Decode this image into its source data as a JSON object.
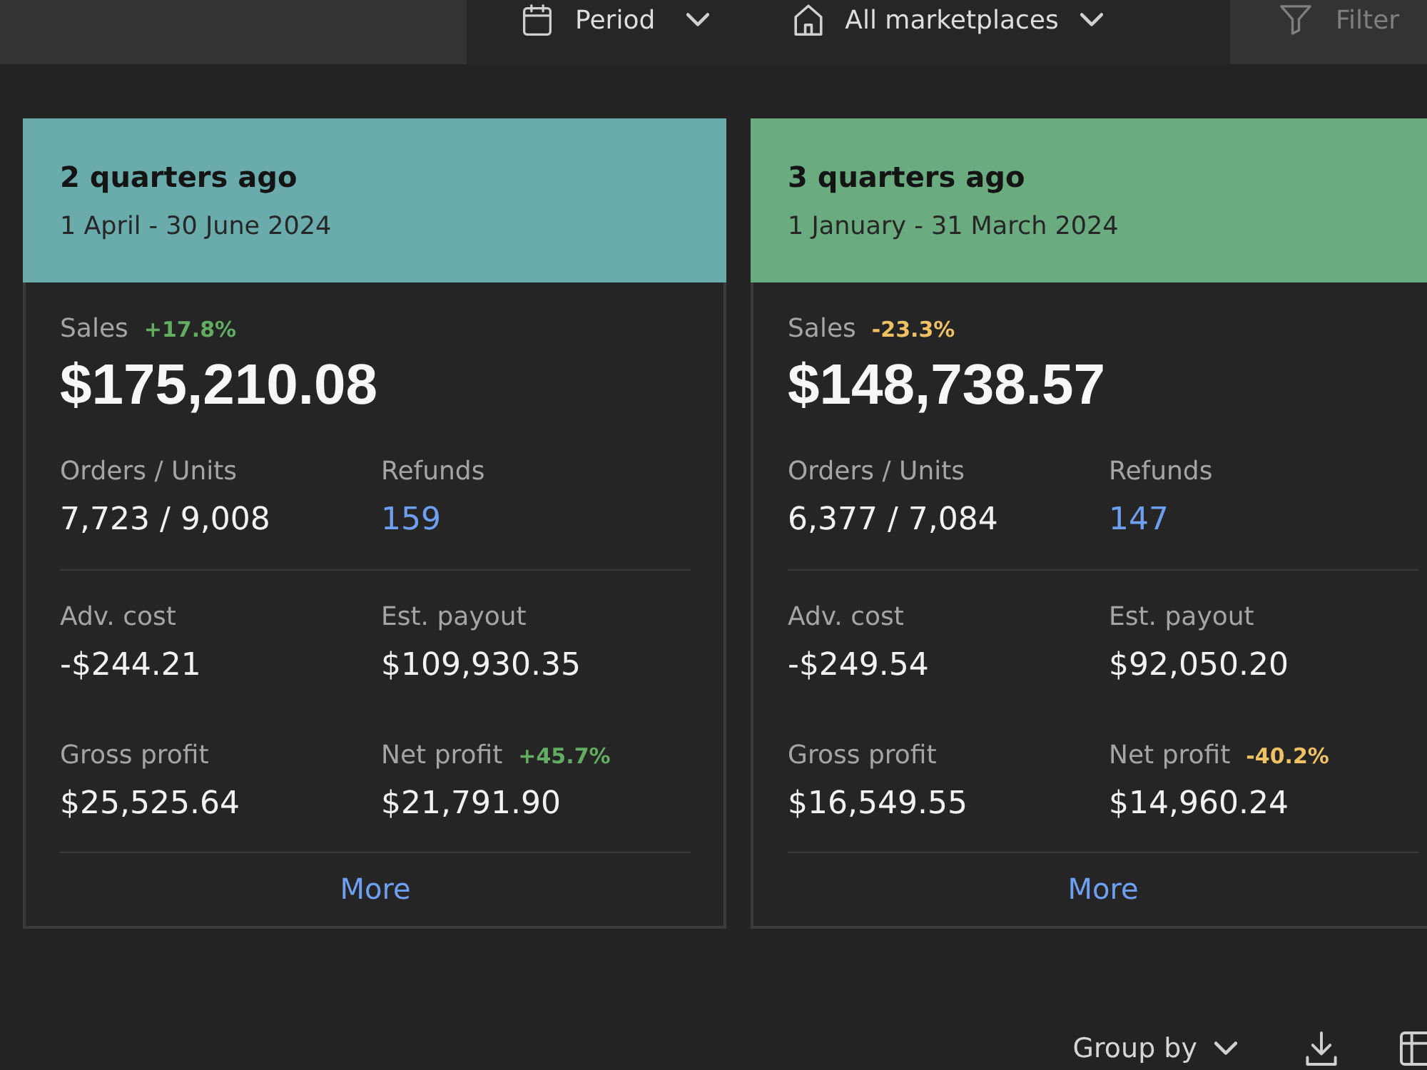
{
  "toolbar": {
    "period": {
      "label": "Period"
    },
    "marketplace": {
      "label": "All marketplaces"
    },
    "filter": {
      "label": "Filter",
      "disabled": true
    }
  },
  "cards": [
    {
      "title": "2 quarters ago",
      "dates": "1 April - 30 June 2024",
      "color": "#6aabac",
      "sales": {
        "label": "Sales",
        "change": {
          "text": "+17.8%",
          "positive": true
        },
        "value": "$175,210.08"
      },
      "metric_groups": [
        [
          {
            "label": "Orders / Units",
            "value": "7,723 / 9,008",
            "link": false
          },
          {
            "label": "Refunds",
            "value": "159",
            "link": true
          }
        ],
        [
          {
            "label": "Adv. cost",
            "value": "-$244.21",
            "link": false
          },
          {
            "label": "Est. payout",
            "value": "$109,930.35",
            "link": false
          },
          {
            "label": "Gross profit",
            "value": "$25,525.64",
            "link": false
          },
          {
            "label": "Net profit",
            "value": "$21,791.90",
            "link": false,
            "change": {
              "text": "+45.7%",
              "positive": true
            }
          }
        ]
      ],
      "more": "More"
    },
    {
      "title": "3 quarters ago",
      "dates": "1 January - 31 March 2024",
      "color": "#6aab7f",
      "sales": {
        "label": "Sales",
        "change": {
          "text": "-23.3%",
          "positive": false
        },
        "value": "$148,738.57"
      },
      "metric_groups": [
        [
          {
            "label": "Orders / Units",
            "value": "6,377 / 7,084",
            "link": false
          },
          {
            "label": "Refunds",
            "value": "147",
            "link": true
          }
        ],
        [
          {
            "label": "Adv. cost",
            "value": "-$249.54",
            "link": false
          },
          {
            "label": "Est. payout",
            "value": "$92,050.20",
            "link": false
          },
          {
            "label": "Gross profit",
            "value": "$16,549.55",
            "link": false
          },
          {
            "label": "Net profit",
            "value": "$14,960.24",
            "link": false,
            "change": {
              "text": "-40.2%",
              "positive": false
            }
          }
        ]
      ],
      "more": "More"
    }
  ],
  "footer": {
    "group_by": "Group by"
  }
}
